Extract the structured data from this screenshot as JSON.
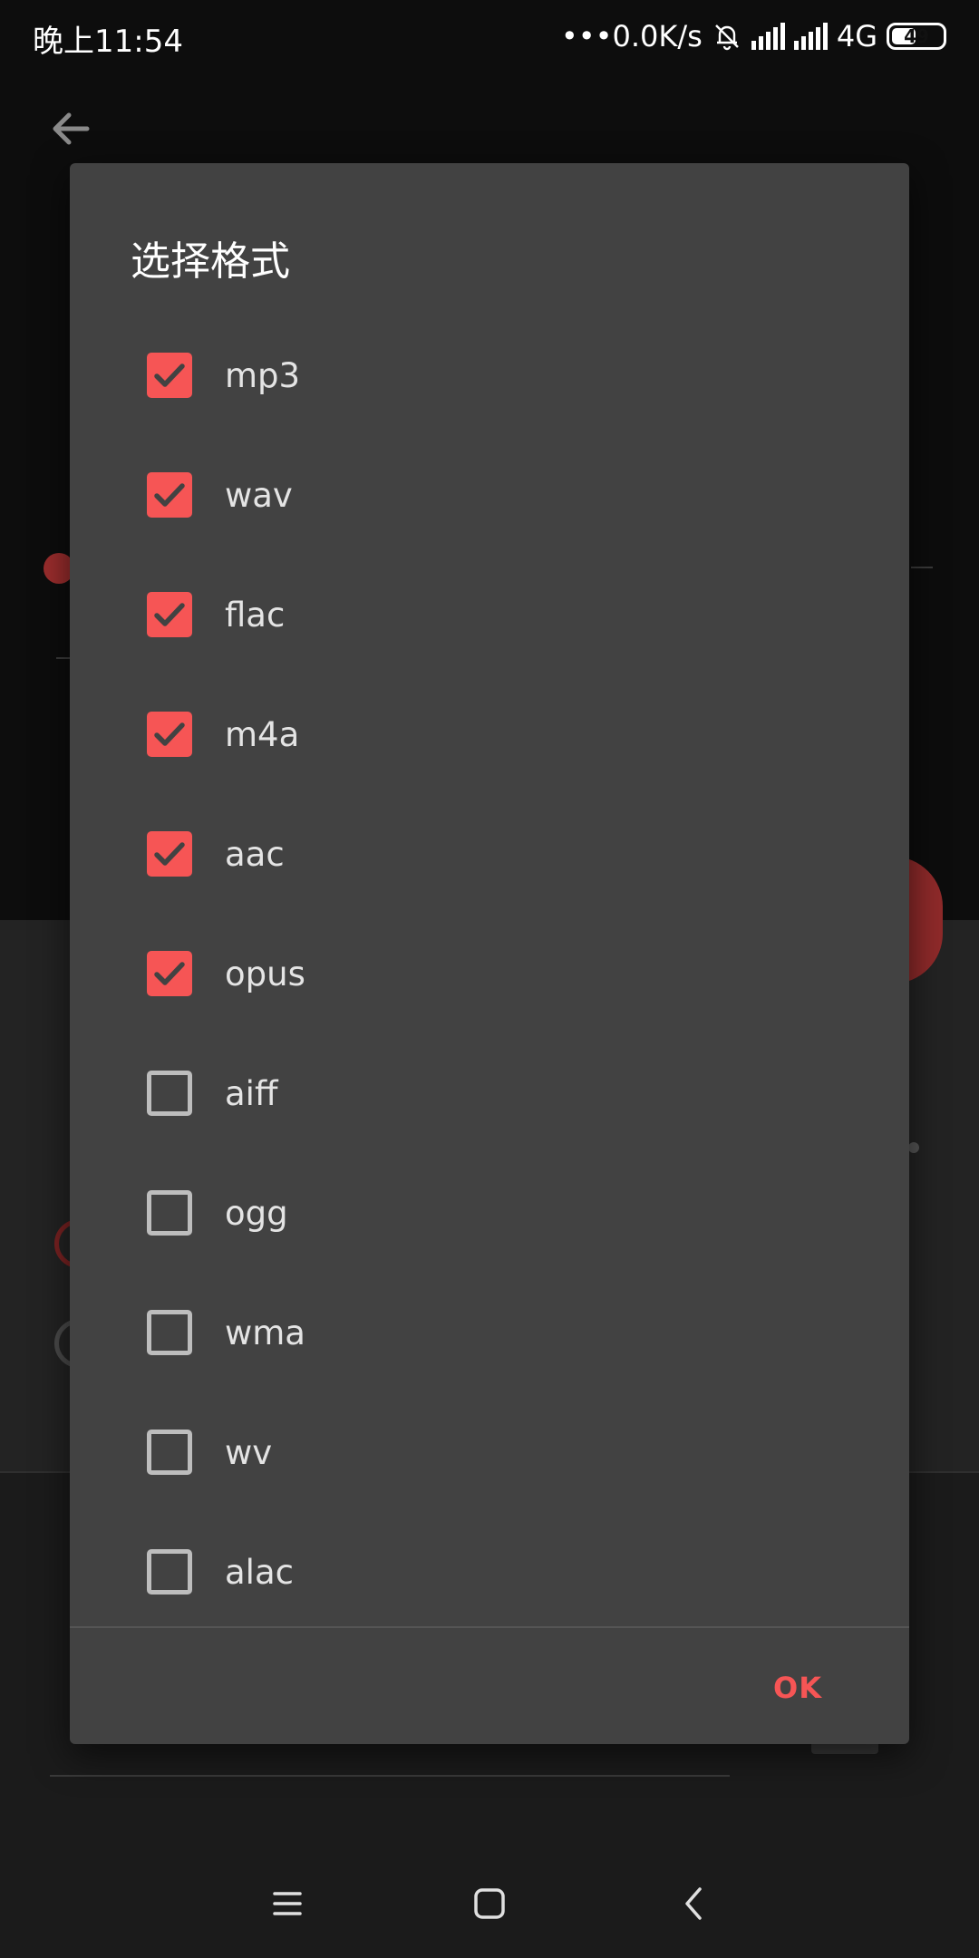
{
  "status_bar": {
    "time": "晚上11:54",
    "speed": "•••0.0K/s",
    "network": "4G",
    "battery": "49"
  },
  "dialog": {
    "title": "选择格式",
    "options": [
      {
        "label": "mp3",
        "checked": true
      },
      {
        "label": "wav",
        "checked": true
      },
      {
        "label": "flac",
        "checked": true
      },
      {
        "label": "m4a",
        "checked": true
      },
      {
        "label": "aac",
        "checked": true
      },
      {
        "label": "opus",
        "checked": true
      },
      {
        "label": "aiff",
        "checked": false
      },
      {
        "label": "ogg",
        "checked": false
      },
      {
        "label": "wma",
        "checked": false
      },
      {
        "label": "wv",
        "checked": false
      },
      {
        "label": "alac",
        "checked": false
      }
    ],
    "ok_label": "OK"
  },
  "colors": {
    "accent": "#f65555",
    "dialog_bg": "#424242",
    "unchecked_border": "#bdbdbd"
  },
  "icons": {
    "back": "arrow-left-icon",
    "mute": "bell-off-icon",
    "nav_menu": "menu-icon",
    "nav_home": "home-square-icon",
    "nav_back": "chevron-left-icon"
  }
}
